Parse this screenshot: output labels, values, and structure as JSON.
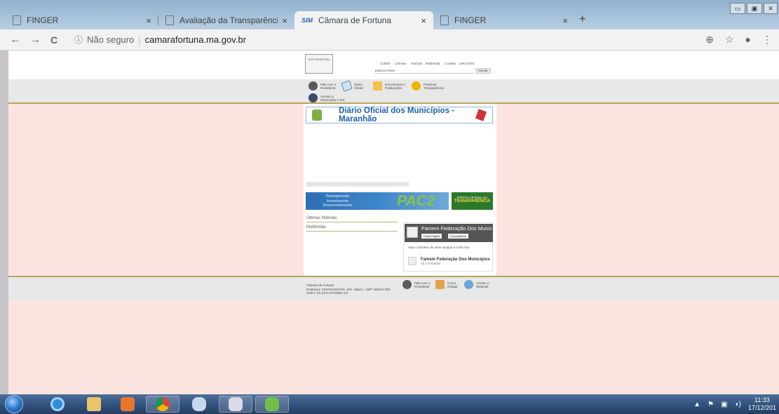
{
  "browser": {
    "tabs": [
      {
        "title": "FINGER",
        "active": false
      },
      {
        "title": "Avaliação da Transparência dos l",
        "active": false
      },
      {
        "title": "Câmara de Fortuna",
        "active": true,
        "favicon": "SIM"
      },
      {
        "title": "FINGER",
        "active": false
      }
    ],
    "new_tab_label": "+",
    "close_label": "×",
    "address": {
      "security_label": "Não seguro",
      "url": "camarafortuna.ma.gov.br"
    },
    "icons": {
      "back": "←",
      "forward": "→",
      "reload": "C",
      "info": "ⓘ",
      "zoom": "⊕",
      "star": "☆",
      "profile": "●",
      "menu": "⋮"
    },
    "window_controls": [
      "▭",
      "▣",
      "✕"
    ]
  },
  "site": {
    "logo_text": "SITE MUNICIPAL",
    "top_nav": [
      "Cidade ·",
      "Câmara ·",
      "Notícias",
      "Multimídia ·",
      "Contato",
      "Links Úteis"
    ],
    "search_placeholder": "palavra-chave",
    "search_button": "buscar",
    "menu": [
      {
        "label": "Fale com o Presidente"
      },
      {
        "label": "Diário Oficial"
      },
      {
        "label": "Documentos e Publicações"
      },
      {
        "label": "Portal da Transparência"
      },
      {
        "label": "Acesso a informação e-SIC"
      }
    ],
    "banner_title": "Diário Oficial dos Municípios - Maranhão",
    "pac": {
      "lines": "Planejamento Investimento Desenvolvimento",
      "big": "PAC2"
    },
    "portal": {
      "small": "PORTAL OFICIAL DA",
      "big": "TRANSPARÊNCIA"
    },
    "side_links": [
      "Últimas Notícias",
      "Multimídia"
    ],
    "facebook": {
      "cover_title": "Famem Federação Dos Munic",
      "like_button": "Curtir Página",
      "share_button": "Compartilhar",
      "be_first": "Seja o primeiro de seus amigos a curtir isso.",
      "page_name": "Famem Federação Dos Municípios",
      "time_ago": "há 3 semanas"
    },
    "footer": {
      "name": "Câmara de Fortuna",
      "address": "Endereço: XXXXXXXXXXX, S/N - Bairro - CEP: 65XXX-000",
      "cnpj": "CNPJ: XX.XXX.XXX/0001-XX",
      "items": [
        "Fale com o Presidente",
        "Como Chegar",
        "Acesso o Webmail"
      ]
    }
  },
  "taskbar": {
    "clock_time": "11:33",
    "clock_date": "17/12/201"
  }
}
